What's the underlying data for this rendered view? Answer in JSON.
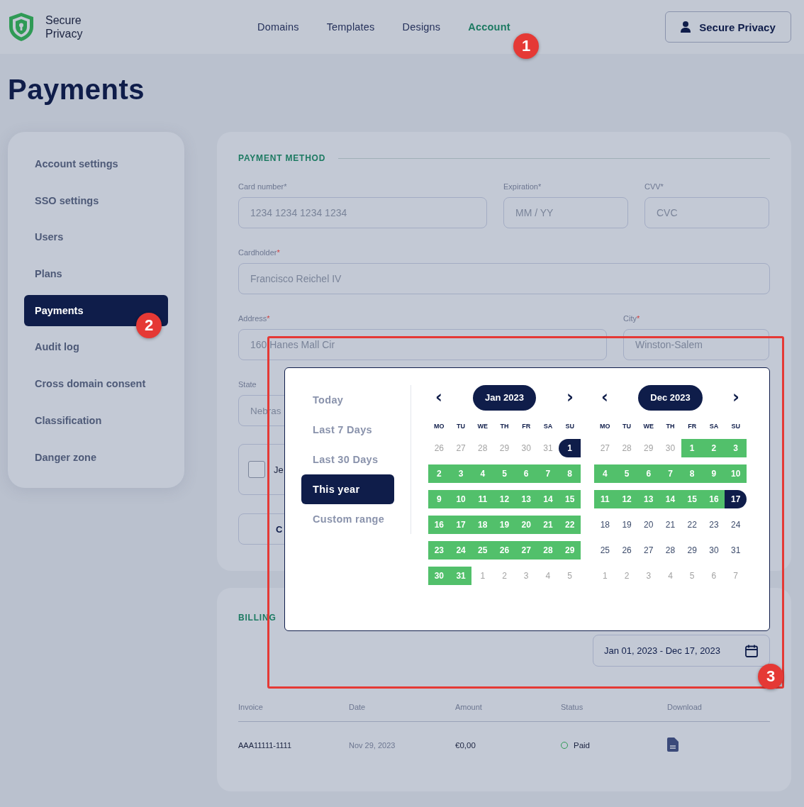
{
  "header": {
    "logo_text": "Secure Privacy",
    "nav": [
      {
        "label": "Domains",
        "selected": false
      },
      {
        "label": "Templates",
        "selected": false
      },
      {
        "label": "Designs",
        "selected": false
      },
      {
        "label": "Account",
        "selected": true
      }
    ],
    "account_button": "Secure Privacy"
  },
  "page_title": "Payments",
  "sidebar": {
    "items": [
      {
        "label": "Account settings",
        "selected": false
      },
      {
        "label": "SSO settings",
        "selected": false
      },
      {
        "label": "Users",
        "selected": false
      },
      {
        "label": "Plans",
        "selected": false
      },
      {
        "label": "Payments",
        "selected": true
      },
      {
        "label": "Audit log",
        "selected": false
      },
      {
        "label": "Cross domain consent",
        "selected": false
      },
      {
        "label": "Classification",
        "selected": false
      },
      {
        "label": "Danger zone",
        "selected": false
      }
    ]
  },
  "payment_method": {
    "title": "PAYMENT METHOD",
    "card_row": [
      {
        "label": "Card number*",
        "placeholder": "1234 1234 1234 1234"
      },
      {
        "label": "Expiration*",
        "placeholder": "MM / YY"
      },
      {
        "label": "CVV*",
        "placeholder": "CVC"
      }
    ],
    "cardholder": {
      "label": "Cardholder",
      "required_mark": "*",
      "value": "Francisco Reichel IV"
    },
    "address": {
      "label": "Address",
      "required_mark": "*",
      "value": "160 Hanes Mall Cir"
    },
    "city": {
      "label": "City",
      "required_mark": "*",
      "value": "Winston-Salem"
    },
    "state": {
      "label": "State",
      "value": "Nebras"
    },
    "checkbox": {
      "label": "Je",
      "checked": false
    },
    "button": "C"
  },
  "billing": {
    "title": "BILLING",
    "date_range": "Jan 01, 2023 - Dec 17, 2023",
    "columns": [
      "Invoice",
      "Date",
      "Amount",
      "Status",
      "Download"
    ],
    "rows": [
      {
        "invoice": "AAA11111-1111",
        "date": "Nov 29, 2023",
        "amount": "€0,00",
        "status": "Paid"
      }
    ]
  },
  "date_picker": {
    "presets": [
      {
        "label": "Today",
        "selected": false
      },
      {
        "label": "Last 7 Days",
        "selected": false
      },
      {
        "label": "Last 30 Days",
        "selected": false
      },
      {
        "label": "This year",
        "selected": true
      },
      {
        "label": "Custom range",
        "selected": false
      }
    ],
    "prev": "‹",
    "next": "›",
    "months": [
      {
        "title": "Jan 2023",
        "weekdays": [
          "MO",
          "TU",
          "WE",
          "TH",
          "FR",
          "SA",
          "SU"
        ],
        "weeks": [
          [
            {
              "day": "26",
              "kind": "outside"
            },
            {
              "day": "27",
              "kind": "outside"
            },
            {
              "day": "28",
              "kind": "outside"
            },
            {
              "day": "29",
              "kind": "outside"
            },
            {
              "day": "30",
              "kind": "outside"
            },
            {
              "day": "31",
              "kind": "outside"
            },
            {
              "day": "1",
              "kind": "start"
            }
          ],
          [
            {
              "day": "2",
              "kind": "range"
            },
            {
              "day": "3",
              "kind": "range"
            },
            {
              "day": "4",
              "kind": "range"
            },
            {
              "day": "5",
              "kind": "range"
            },
            {
              "day": "6",
              "kind": "range"
            },
            {
              "day": "7",
              "kind": "range"
            },
            {
              "day": "8",
              "kind": "range"
            }
          ],
          [
            {
              "day": "9",
              "kind": "range"
            },
            {
              "day": "10",
              "kind": "range"
            },
            {
              "day": "11",
              "kind": "range"
            },
            {
              "day": "12",
              "kind": "range"
            },
            {
              "day": "13",
              "kind": "range"
            },
            {
              "day": "14",
              "kind": "range"
            },
            {
              "day": "15",
              "kind": "range"
            }
          ],
          [
            {
              "day": "16",
              "kind": "range"
            },
            {
              "day": "17",
              "kind": "range"
            },
            {
              "day": "18",
              "kind": "range"
            },
            {
              "day": "19",
              "kind": "range"
            },
            {
              "day": "20",
              "kind": "range"
            },
            {
              "day": "21",
              "kind": "range"
            },
            {
              "day": "22",
              "kind": "range"
            }
          ],
          [
            {
              "day": "23",
              "kind": "range"
            },
            {
              "day": "24",
              "kind": "range"
            },
            {
              "day": "25",
              "kind": "range"
            },
            {
              "day": "26",
              "kind": "range"
            },
            {
              "day": "27",
              "kind": "range"
            },
            {
              "day": "28",
              "kind": "range"
            },
            {
              "day": "29",
              "kind": "range"
            }
          ],
          [
            {
              "day": "30",
              "kind": "range"
            },
            {
              "day": "31",
              "kind": "range"
            },
            {
              "day": "1",
              "kind": "outside"
            },
            {
              "day": "2",
              "kind": "outside"
            },
            {
              "day": "3",
              "kind": "outside"
            },
            {
              "day": "4",
              "kind": "outside"
            },
            {
              "day": "5",
              "kind": "outside"
            }
          ]
        ]
      },
      {
        "title": "Dec 2023",
        "weekdays": [
          "MO",
          "TU",
          "WE",
          "TH",
          "FR",
          "SA",
          "SU"
        ],
        "weeks": [
          [
            {
              "day": "27",
              "kind": "outside"
            },
            {
              "day": "28",
              "kind": "outside"
            },
            {
              "day": "29",
              "kind": "outside"
            },
            {
              "day": "30",
              "kind": "outside"
            },
            {
              "day": "1",
              "kind": "range"
            },
            {
              "day": "2",
              "kind": "range"
            },
            {
              "day": "3",
              "kind": "range"
            }
          ],
          [
            {
              "day": "4",
              "kind": "range"
            },
            {
              "day": "5",
              "kind": "range"
            },
            {
              "day": "6",
              "kind": "range"
            },
            {
              "day": "7",
              "kind": "range"
            },
            {
              "day": "8",
              "kind": "range"
            },
            {
              "day": "9",
              "kind": "range"
            },
            {
              "day": "10",
              "kind": "range"
            }
          ],
          [
            {
              "day": "11",
              "kind": "range"
            },
            {
              "day": "12",
              "kind": "range"
            },
            {
              "day": "13",
              "kind": "range"
            },
            {
              "day": "14",
              "kind": "range"
            },
            {
              "day": "15",
              "kind": "range"
            },
            {
              "day": "16",
              "kind": "range"
            },
            {
              "day": "17",
              "kind": "end"
            }
          ],
          [
            {
              "day": "18",
              "kind": "plain"
            },
            {
              "day": "19",
              "kind": "plain"
            },
            {
              "day": "20",
              "kind": "plain"
            },
            {
              "day": "21",
              "kind": "plain"
            },
            {
              "day": "22",
              "kind": "plain"
            },
            {
              "day": "23",
              "kind": "plain"
            },
            {
              "day": "24",
              "kind": "plain"
            }
          ],
          [
            {
              "day": "25",
              "kind": "plain"
            },
            {
              "day": "26",
              "kind": "plain"
            },
            {
              "day": "27",
              "kind": "plain"
            },
            {
              "day": "28",
              "kind": "plain"
            },
            {
              "day": "29",
              "kind": "plain"
            },
            {
              "day": "30",
              "kind": "plain"
            },
            {
              "day": "31",
              "kind": "plain"
            }
          ],
          [
            {
              "day": "1",
              "kind": "outside"
            },
            {
              "day": "2",
              "kind": "outside"
            },
            {
              "day": "3",
              "kind": "outside"
            },
            {
              "day": "4",
              "kind": "outside"
            },
            {
              "day": "5",
              "kind": "outside"
            },
            {
              "day": "6",
              "kind": "outside"
            },
            {
              "day": "7",
              "kind": "outside"
            }
          ]
        ]
      }
    ]
  },
  "annotations": {
    "badges": [
      "1",
      "2",
      "3"
    ],
    "highlight_frame": true
  }
}
